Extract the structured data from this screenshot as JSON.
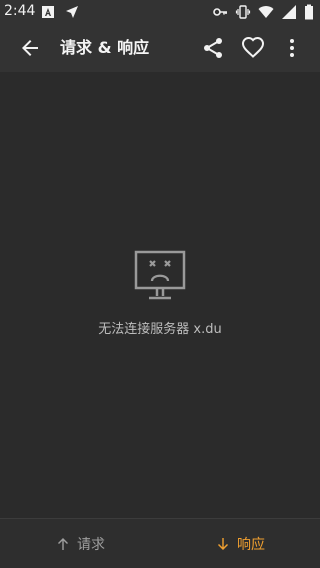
{
  "status_bar": {
    "time": "2:44"
  },
  "app_bar": {
    "title": "请求 & 响应"
  },
  "error": {
    "message": "无法连接服务器 x.du"
  },
  "bottom_tabs": [
    {
      "label": "请求",
      "icon": "arrow-up-icon",
      "active": false
    },
    {
      "label": "响应",
      "icon": "arrow-down-icon",
      "active": true
    }
  ],
  "colors": {
    "accent": "#f0a030",
    "background": "#2b2b2b",
    "appbar": "#333333"
  }
}
